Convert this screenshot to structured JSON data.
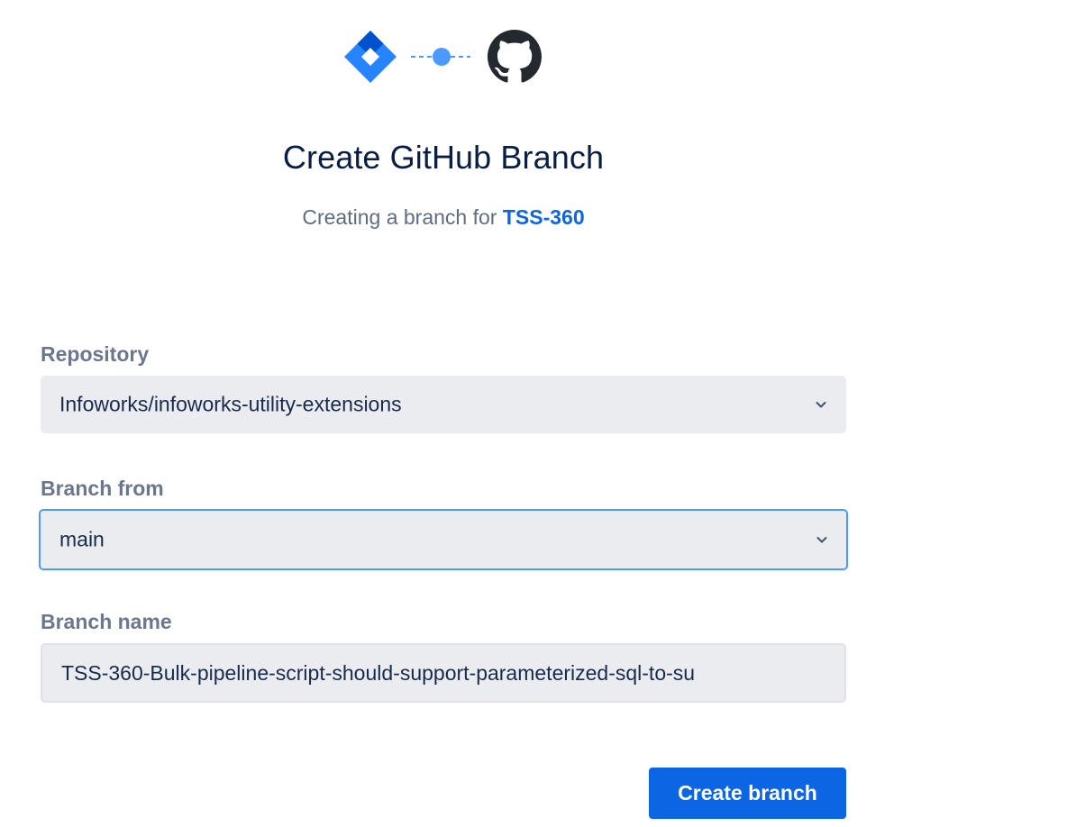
{
  "header": {
    "jira_logo_icon": "jira-logo-icon",
    "connector_icon": "connector-dots-icon",
    "github_logo_icon": "github-logo-icon",
    "title": "Create GitHub Branch",
    "subtitle_prefix": "Creating a branch for",
    "issue_key": "TSS-360"
  },
  "form": {
    "repository": {
      "label": "Repository",
      "value": "Infoworks/infoworks-utility-extensions"
    },
    "branch_from": {
      "label": "Branch from",
      "value": "main"
    },
    "branch_name": {
      "label": "Branch name",
      "value": "TSS-360-Bulk-pipeline-script-should-support-parameterized-sql-to-su"
    },
    "submit_label": "Create branch"
  },
  "colors": {
    "primary": "#0c66e4",
    "focus_ring": "#4c9aff",
    "field_bg": "#ebecf0",
    "label": "#6b778c"
  }
}
